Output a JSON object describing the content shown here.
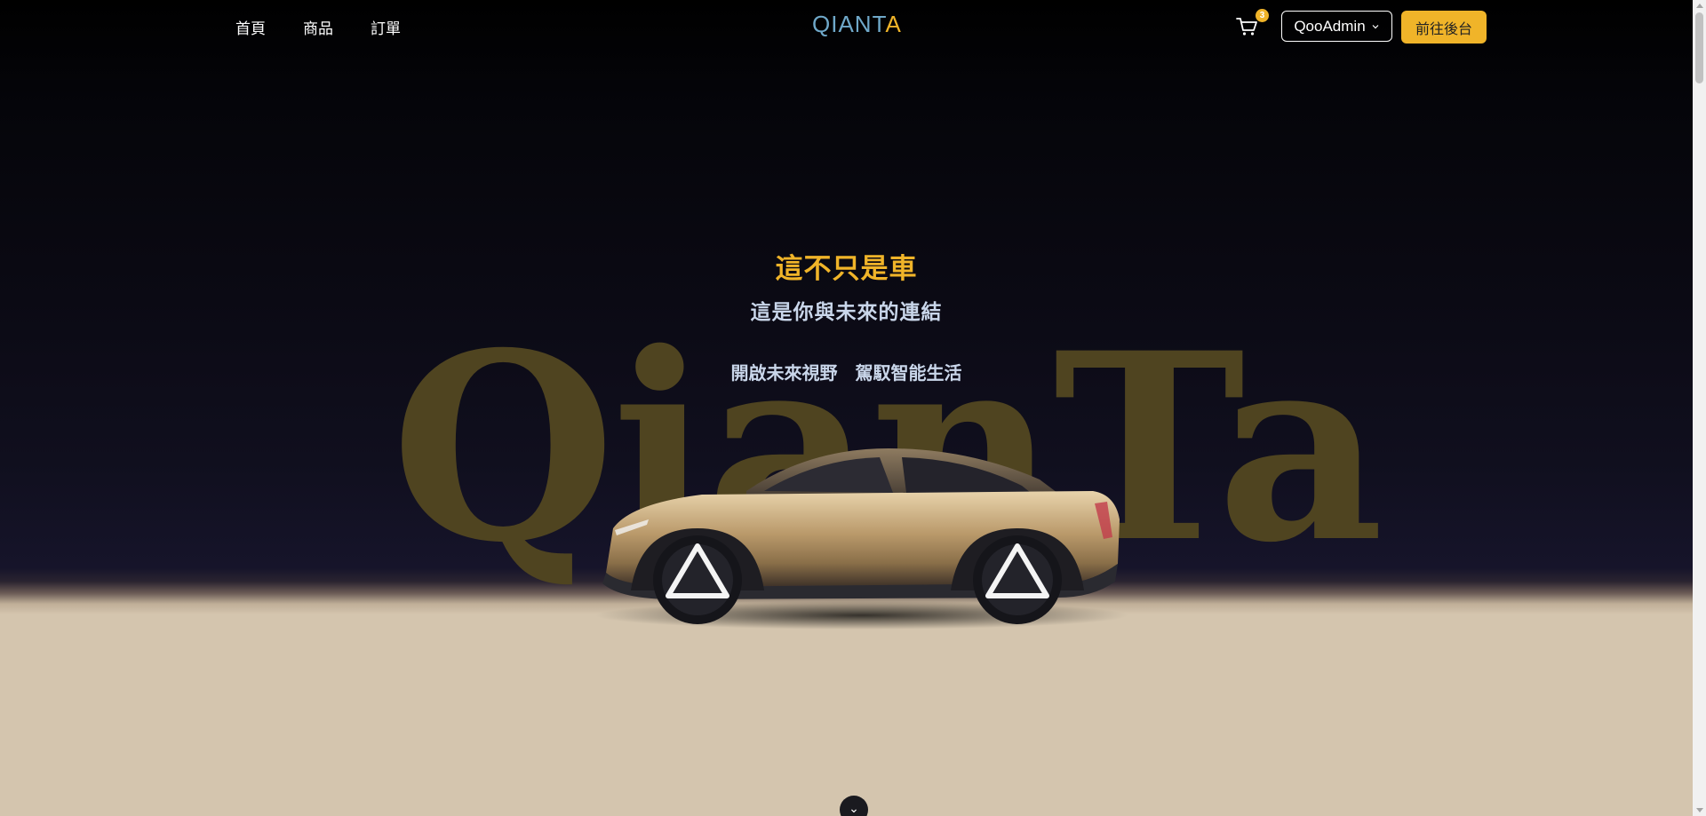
{
  "nav": {
    "links": [
      {
        "label": "首頁"
      },
      {
        "label": "商品"
      },
      {
        "label": "訂單"
      }
    ],
    "brand_main": "QIANT",
    "brand_accent": "A",
    "cart_count": "3",
    "user_label": "QooAdmin",
    "admin_button": "前往後台"
  },
  "hero": {
    "watermark": "QianTa",
    "headline": "這不只是車",
    "subheadline": "這是你與未來的連結",
    "tagline": "開啟未來視野　駕馭智能生活",
    "scroll_icon": "⌄"
  },
  "colors": {
    "accent": "#f0b429",
    "brand_blue": "#6fa8c9",
    "text_light": "#c9d6ea",
    "floor": "#d4c5ae",
    "watermark": "#4f4420"
  },
  "icons": {
    "cart": "cart-icon",
    "dropdown": "chevron-down-icon",
    "scroll": "chevron-down-icon"
  }
}
